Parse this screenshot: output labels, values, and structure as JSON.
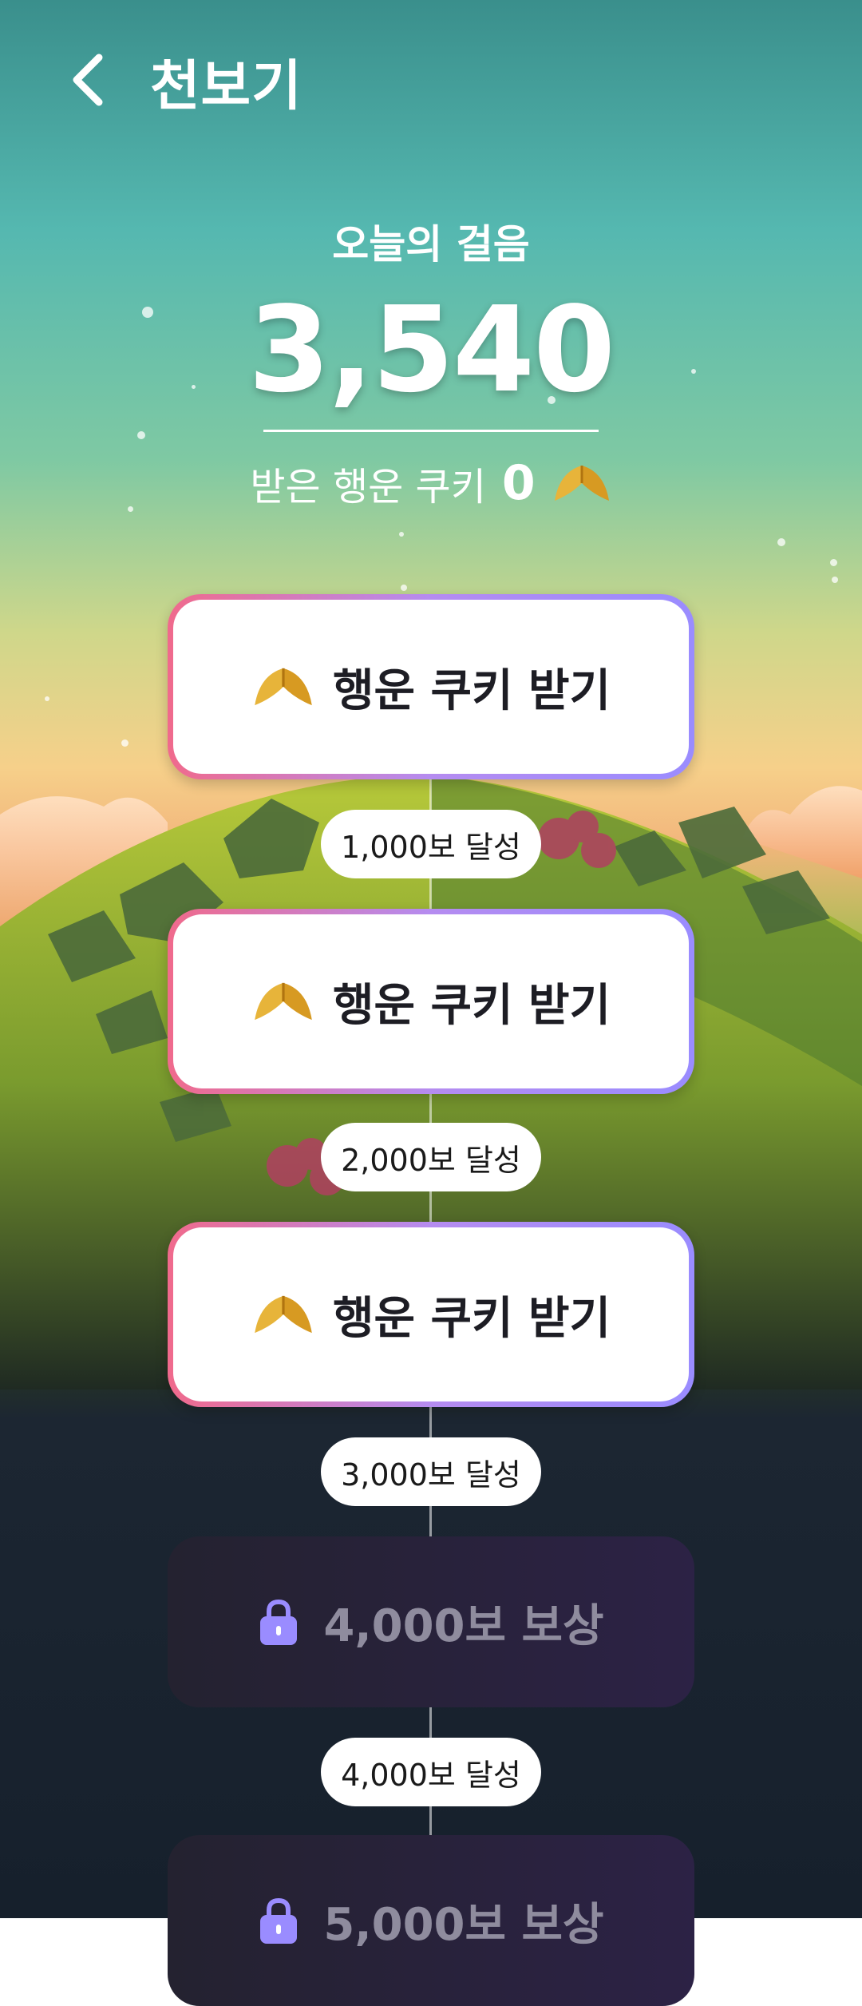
{
  "header": {
    "title": "천보기"
  },
  "today": {
    "label": "오늘의 걸음",
    "steps": "3,540"
  },
  "cookies": {
    "label": "받은 행운 쿠키",
    "count": "0"
  },
  "rewards": [
    {
      "label": "행운 쿠키 받기"
    },
    {
      "label": "행운 쿠키 받기"
    },
    {
      "label": "행운 쿠키 받기"
    }
  ],
  "milestones": [
    "1,000보 달성",
    "2,000보 달성",
    "3,000보 달성",
    "4,000보 달성"
  ],
  "locked": [
    {
      "label": "4,000보 보상"
    },
    {
      "label": "5,000보 보상"
    }
  ],
  "colors": {
    "accent_pink": "#f06a8c",
    "accent_purple": "#9a8cff",
    "lock": "#9a8cff"
  },
  "icons": {
    "back": "chevron-left-icon",
    "cookie": "fortune-cookie-icon",
    "lock": "lock-icon"
  }
}
